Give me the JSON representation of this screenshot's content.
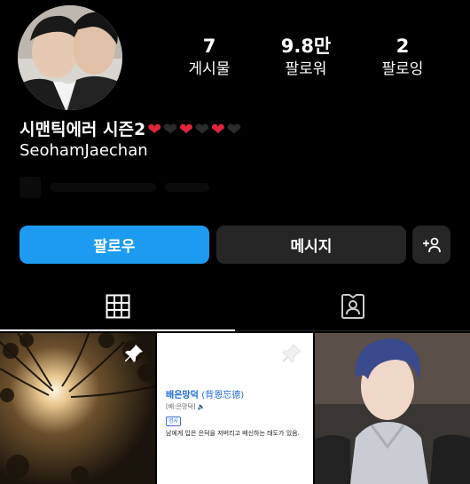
{
  "profile": {
    "bio_title": "시맨틱에러 시즌2",
    "hearts": [
      "red",
      "black",
      "red",
      "black",
      "red",
      "black"
    ],
    "username": "SeohamJaechan"
  },
  "stats": [
    {
      "number": "7",
      "label": "게시물"
    },
    {
      "number": "9.8만",
      "label": "팔로워"
    },
    {
      "number": "2",
      "label": "팔로잉"
    }
  ],
  "actions": {
    "follow_label": "팔로우",
    "message_label": "메시지",
    "add_person_icon": "person-add-icon"
  },
  "tabs": [
    {
      "icon": "grid-icon",
      "selected": true
    },
    {
      "icon": "tagged-person-icon",
      "selected": false
    }
  ],
  "posts": [
    {
      "type": "photo",
      "description_icon": "pin-icon",
      "pinned": true
    },
    {
      "type": "dictionary-card",
      "pinned": true,
      "word": "배은망덕",
      "hanja": "(背恩忘德)",
      "reading": "[배:은망덕]",
      "tag": "명사",
      "definition": "남에게 입은 은덕을 저버리고 배신하는 태도가 있음."
    },
    {
      "type": "photo",
      "pinned": false
    }
  ],
  "colors": {
    "background": "#000000",
    "follow_button": "#1d9bf0",
    "secondary_button": "#262626",
    "heart_red": "#e0243a"
  }
}
